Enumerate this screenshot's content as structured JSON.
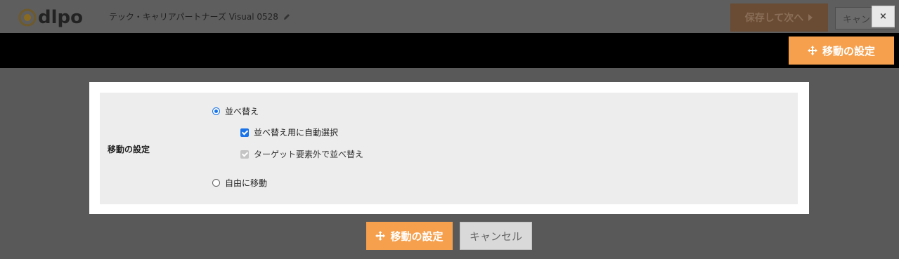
{
  "header": {
    "logo_text": "dlpo",
    "doc_title": "テック・キャリアパートナーズ Visual 0528",
    "save_next_label": "保存して次へ",
    "cancel_label": "キャン",
    "close_label": "×"
  },
  "toolbar": {
    "move_label": "移動の設定"
  },
  "panel": {
    "row_label": "移動の設定",
    "radio_sort_label": "並べ替え",
    "check_auto_select_label": "並べ替え用に自動選択",
    "check_outside_label": "ターゲット要素外で並べ替え",
    "radio_free_label": "自由に移動"
  },
  "state": {
    "radio_sort_selected": true,
    "check_auto_select_checked": true,
    "check_outside_checked": true,
    "check_outside_disabled": true,
    "radio_free_selected": false
  },
  "footer": {
    "move_label": "移動の設定",
    "cancel_label": "キャンセル"
  },
  "colors": {
    "accent_orange": "#f6a04d",
    "checkbox_blue": "#1a73e8",
    "overlay_gray": "#595959"
  }
}
